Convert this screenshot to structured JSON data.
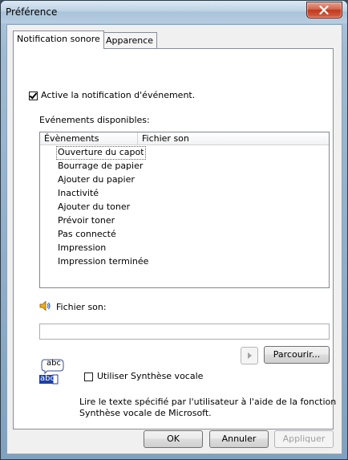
{
  "window": {
    "title": "Préférence"
  },
  "tabs": [
    {
      "label": "Notification sonore",
      "active": true
    },
    {
      "label": "Apparence",
      "active": false
    }
  ],
  "notification": {
    "enable_label": "Active la notification d'événement.",
    "enable_checked": true,
    "events_label": "Evénements disponibles:"
  },
  "events_table": {
    "columns": [
      "Évènements",
      "Fichier son"
    ],
    "rows": [
      {
        "event": "Ouverture du capot",
        "sound": ""
      },
      {
        "event": "Bourrage de papier",
        "sound": ""
      },
      {
        "event": "Ajouter du papier",
        "sound": ""
      },
      {
        "event": "Inactivité",
        "sound": ""
      },
      {
        "event": "Ajouter du toner",
        "sound": ""
      },
      {
        "event": "Prévoir toner",
        "sound": ""
      },
      {
        "event": "Pas connecté",
        "sound": ""
      },
      {
        "event": "Impression",
        "sound": ""
      },
      {
        "event": "Impression terminée",
        "sound": ""
      }
    ]
  },
  "sound_file": {
    "label": "Fichier son:",
    "value": "",
    "icon": "speaker-icon",
    "browse_label": "Parcourir..."
  },
  "speech": {
    "label": "Utiliser Synthèse vocale",
    "checked": false,
    "icon": "text-to-speech-icon",
    "icon_text_top": "abc",
    "icon_text_bottom": "abc",
    "description_line1": "Lire le texte spécifié par l'utilisateur à l'aide de la fonction",
    "description_line2": "Synthèse vocale de Microsoft."
  },
  "buttons": {
    "ok": "OK",
    "cancel": "Annuler",
    "apply": "Appliquer"
  },
  "colors": {
    "accent": "#3399ff",
    "close_button": "#c1371c"
  }
}
